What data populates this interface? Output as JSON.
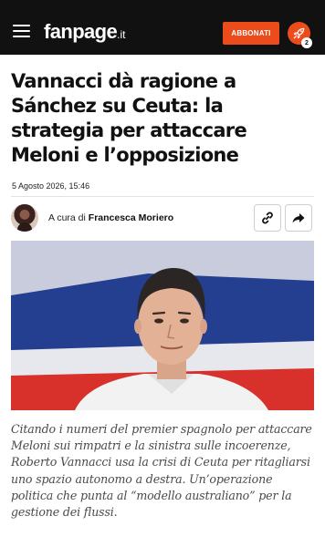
{
  "header": {
    "logo_text": "fanpage",
    "logo_tld": ".it",
    "subscribe_label": "ABBONATI",
    "notification_count": "2"
  },
  "article": {
    "headline": "Vannacci dà ragione a Sánchez su Ceuta: la strategia per attaccare Meloni e l’opposizione",
    "date": "5 Agosto 2026, 15:46",
    "byline_prefix": "A cura di",
    "author": "Francesca Moriero",
    "lede": "Citando i numeri del premier spagnolo per attaccare Meloni sui rimpatri e la sinistra sulle incoerenze, Roberto Vannacci usa la crisi di Ceuta per ritagliarsi uno spazio autonomo a destra. Un’operazione politica che punta al “modello australiano” per la gestione dei flussi."
  },
  "colors": {
    "accent": "#ec4c1b",
    "header_bg": "#111111",
    "text": "#111111",
    "lede_text": "#4a4a4a"
  },
  "icons": {
    "menu": "hamburger-icon",
    "notifications": "rocket-icon",
    "copy_link": "link-icon",
    "share": "share-arrow-icon"
  }
}
